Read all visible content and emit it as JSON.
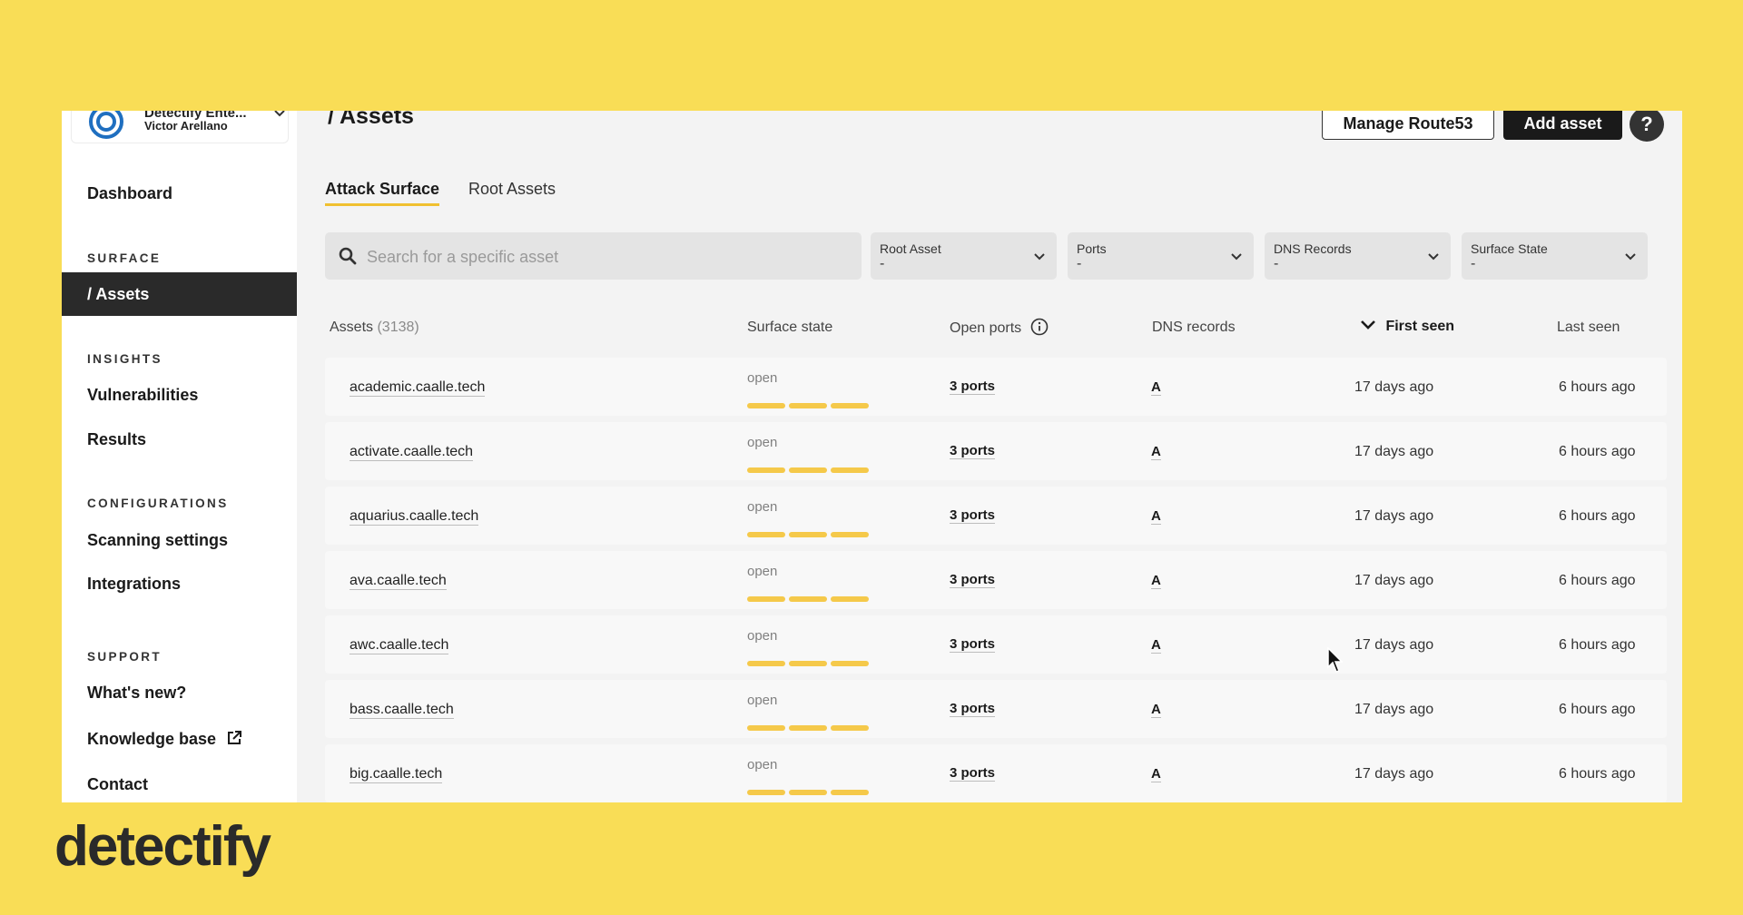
{
  "workspace": {
    "name": "Detectify Ente...",
    "user": "Victor Arellano"
  },
  "sidebar": {
    "dashboard": "Dashboard",
    "sections": {
      "surface": "SURFACE",
      "insights": "INSIGHTS",
      "configurations": "CONFIGURATIONS",
      "support": "SUPPORT"
    },
    "assets": "/ Assets",
    "vulnerabilities": "Vulnerabilities",
    "results": "Results",
    "scanning_settings": "Scanning settings",
    "integrations": "Integrations",
    "whats_new": "What's new?",
    "knowledge_base": "Knowledge base",
    "contact": "Contact"
  },
  "header": {
    "title": "/ Assets",
    "manage_label": "Manage Route53",
    "add_label": "Add asset",
    "help_label": "?"
  },
  "tabs": [
    {
      "label": "Attack Surface",
      "active": true
    },
    {
      "label": "Root Assets",
      "active": false
    }
  ],
  "search": {
    "placeholder": "Search for a specific asset",
    "value": ""
  },
  "filters": [
    {
      "label": "Root Asset",
      "value": "-"
    },
    {
      "label": "Ports",
      "value": "-"
    },
    {
      "label": "DNS Records",
      "value": "-"
    },
    {
      "label": "Surface State",
      "value": "-"
    }
  ],
  "table": {
    "columns": {
      "assets": "Assets",
      "assets_count": "(3138)",
      "surface_state": "Surface state",
      "open_ports": "Open ports",
      "dns_records": "DNS records",
      "first_seen": "First seen",
      "last_seen": "Last seen"
    },
    "sort_column": "first_seen",
    "rows": [
      {
        "asset": "academic.caalle.tech",
        "state": "open",
        "ports": "3 ports",
        "dns": "A",
        "first_seen": "17 days ago",
        "last_seen": "6 hours ago"
      },
      {
        "asset": "activate.caalle.tech",
        "state": "open",
        "ports": "3 ports",
        "dns": "A",
        "first_seen": "17 days ago",
        "last_seen": "6 hours ago"
      },
      {
        "asset": "aquarius.caalle.tech",
        "state": "open",
        "ports": "3 ports",
        "dns": "A",
        "first_seen": "17 days ago",
        "last_seen": "6 hours ago"
      },
      {
        "asset": "ava.caalle.tech",
        "state": "open",
        "ports": "3 ports",
        "dns": "A",
        "first_seen": "17 days ago",
        "last_seen": "6 hours ago"
      },
      {
        "asset": "awc.caalle.tech",
        "state": "open",
        "ports": "3 ports",
        "dns": "A",
        "first_seen": "17 days ago",
        "last_seen": "6 hours ago"
      },
      {
        "asset": "bass.caalle.tech",
        "state": "open",
        "ports": "3 ports",
        "dns": "A",
        "first_seen": "17 days ago",
        "last_seen": "6 hours ago"
      },
      {
        "asset": "big.caalle.tech",
        "state": "open",
        "ports": "3 ports",
        "dns": "A",
        "first_seen": "17 days ago",
        "last_seen": "6 hours ago"
      }
    ]
  },
  "brand": {
    "name": "detectify"
  },
  "colors": {
    "background": "#f9dd56",
    "accent": "#f5c94a",
    "dark": "#2a2a2a"
  }
}
